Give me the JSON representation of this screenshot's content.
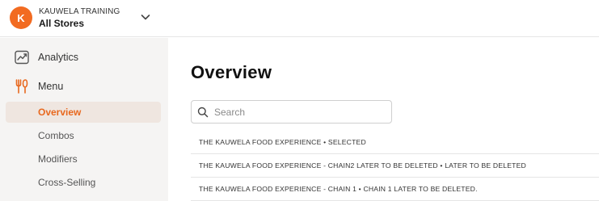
{
  "header": {
    "avatar_letter": "K",
    "org_name": "KAUWELA TRAINING",
    "store_name": "All Stores",
    "accent_color": "#f26b21",
    "chevron_icon": "chevron-down-icon"
  },
  "sidebar": {
    "items": [
      {
        "label": "Analytics",
        "icon": "analytics-chart-icon"
      },
      {
        "label": "Menu",
        "icon": "fork-knife-icon"
      }
    ],
    "sub_items": [
      {
        "label": "Overview",
        "active": true
      },
      {
        "label": "Combos",
        "active": false
      },
      {
        "label": "Modifiers",
        "active": false
      },
      {
        "label": "Cross-Selling",
        "active": false
      }
    ]
  },
  "main": {
    "title": "Overview",
    "search": {
      "placeholder": "Search",
      "value": ""
    },
    "rows": [
      {
        "text": "THE KAUWELA FOOD EXPERIENCE • SELECTED"
      },
      {
        "text": "THE KAUWELA FOOD EXPERIENCE - CHAIN2 LATER TO BE DELETED • LATER TO BE DELETED"
      },
      {
        "text": "THE KAUWELA FOOD EXPERIENCE - CHAIN 1 • CHAIN 1 LATER TO BE DELETED."
      }
    ]
  }
}
